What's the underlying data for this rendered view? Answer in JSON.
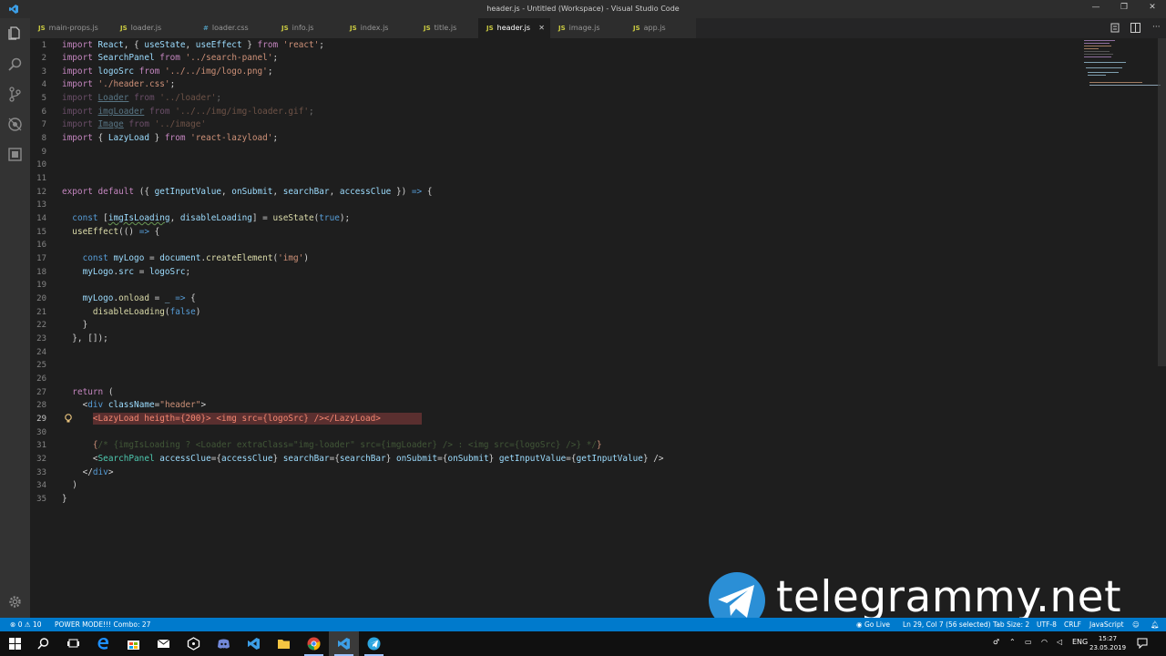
{
  "window": {
    "title": "header.js - Untitled (Workspace) - Visual Studio Code",
    "controls": [
      "—",
      "❐",
      "✕"
    ]
  },
  "tabs": [
    {
      "label": "main-props.js",
      "type": "JS",
      "active": false
    },
    {
      "label": "loader.js",
      "type": "JS",
      "active": false
    },
    {
      "label": "loader.css",
      "type": "#",
      "active": false
    },
    {
      "label": "info.js",
      "type": "JS",
      "active": false
    },
    {
      "label": "index.js",
      "type": "JS",
      "active": false
    },
    {
      "label": "title.js",
      "type": "JS",
      "active": false
    },
    {
      "label": "header.js",
      "type": "JS",
      "active": true
    },
    {
      "label": "image.js",
      "type": "JS",
      "active": false
    },
    {
      "label": "app.js",
      "type": "JS",
      "active": false
    }
  ],
  "editor": {
    "current_line": 29,
    "line_numbers": [
      "1",
      "2",
      "3",
      "4",
      "5",
      "6",
      "7",
      "8",
      "9",
      "10",
      "11",
      "12",
      "13",
      "14",
      "15",
      "16",
      "17",
      "18",
      "19",
      "20",
      "21",
      "22",
      "23",
      "24",
      "25",
      "26",
      "27",
      "28",
      "29",
      "30",
      "31",
      "32",
      "33",
      "34",
      "35"
    ]
  },
  "watermark": {
    "text": "telegrammy.net"
  },
  "statusbar": {
    "errors": "0",
    "warnings": "10",
    "power_mode": "POWER MODE!!! Combo: 27",
    "live_share": "Go Live",
    "position": "Ln 29, Col 7 (56 selected)",
    "tab_size": "Tab Size: 2",
    "encoding": "UTF-8",
    "eol": "CRLF",
    "language": "JavaScript"
  },
  "taskbar": {
    "lang": "ENG",
    "time": "15:27",
    "date": "23.05.2019"
  },
  "colors": {
    "accent": "#007acc",
    "editor_bg": "#1e1e1e",
    "selection": "#5a2f2f"
  }
}
